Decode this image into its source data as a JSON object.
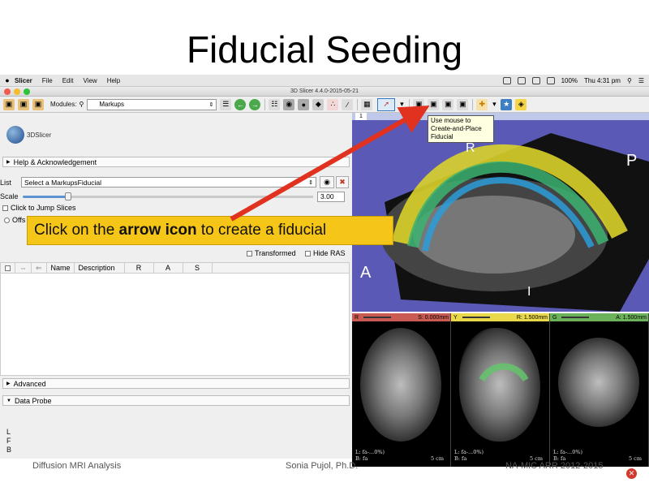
{
  "slide": {
    "title": "Fiducial Seeding"
  },
  "menubar": {
    "apple": "",
    "items": [
      "Slicer",
      "File",
      "Edit",
      "View",
      "Help"
    ],
    "battery": "100%",
    "clock": "Thu 4:31 pm"
  },
  "window": {
    "title": "3D Slicer 4.4.0-2015-05-21"
  },
  "toolbar": {
    "modules_label": "Modules:",
    "module_selected": "Markups",
    "tooltip": "Use mouse to Create-and-Place Fiducial"
  },
  "left_panel": {
    "logo_text": "3DSlicer",
    "help_section": "Help & Acknowledgement",
    "list_label": "List",
    "list_select": "Select a MarkupsFiducial",
    "scale_label": "Scale",
    "scale_value": "3.00",
    "scale_fraction": 0.15,
    "jump_slices": "Click to Jump Slices",
    "offset_label": "Offs",
    "transformed": "Transformed",
    "hide_ras": "Hide RAS",
    "table_columns": [
      "Name",
      "Description",
      "R",
      "A",
      "S"
    ],
    "advanced_section": "Advanced",
    "data_probe_section": "Data Probe",
    "probe_letters": [
      "L",
      "F",
      "B"
    ]
  },
  "viewer_3d": {
    "number": "1",
    "orientation": {
      "r": "R",
      "p": "P",
      "a": "A",
      "i": "I"
    }
  },
  "slice_views": [
    {
      "id": "R",
      "color": "#c95b52",
      "value": "S: 0.000mm",
      "labels": [
        "L: fa-...0%)",
        "B: fa"
      ],
      "scale": "5 cm"
    },
    {
      "id": "Y",
      "color": "#e9d94a",
      "value": "R: 1.500mm",
      "labels": [
        "L: fa-...0%)",
        "B: fa"
      ],
      "scale": "5 cm"
    },
    {
      "id": "G",
      "color": "#6cb25a",
      "value": "A: 1.500mm",
      "labels": [
        "L: fa-...0%)",
        "B: fa"
      ],
      "scale": "5 cm"
    }
  ],
  "callout": {
    "before": "Click on the ",
    "bold": "arrow icon",
    "after": " to create a fiducial"
  },
  "footer": {
    "left": "Diffusion MRI Analysis",
    "center": "Sonia Pujol, Ph.D.",
    "right": "NA-MIC ARR 2012-2015"
  },
  "colors": {
    "callout_bg": "#f5c518",
    "arrow": "#e0321e",
    "view_bg": "#5a5ab6"
  }
}
